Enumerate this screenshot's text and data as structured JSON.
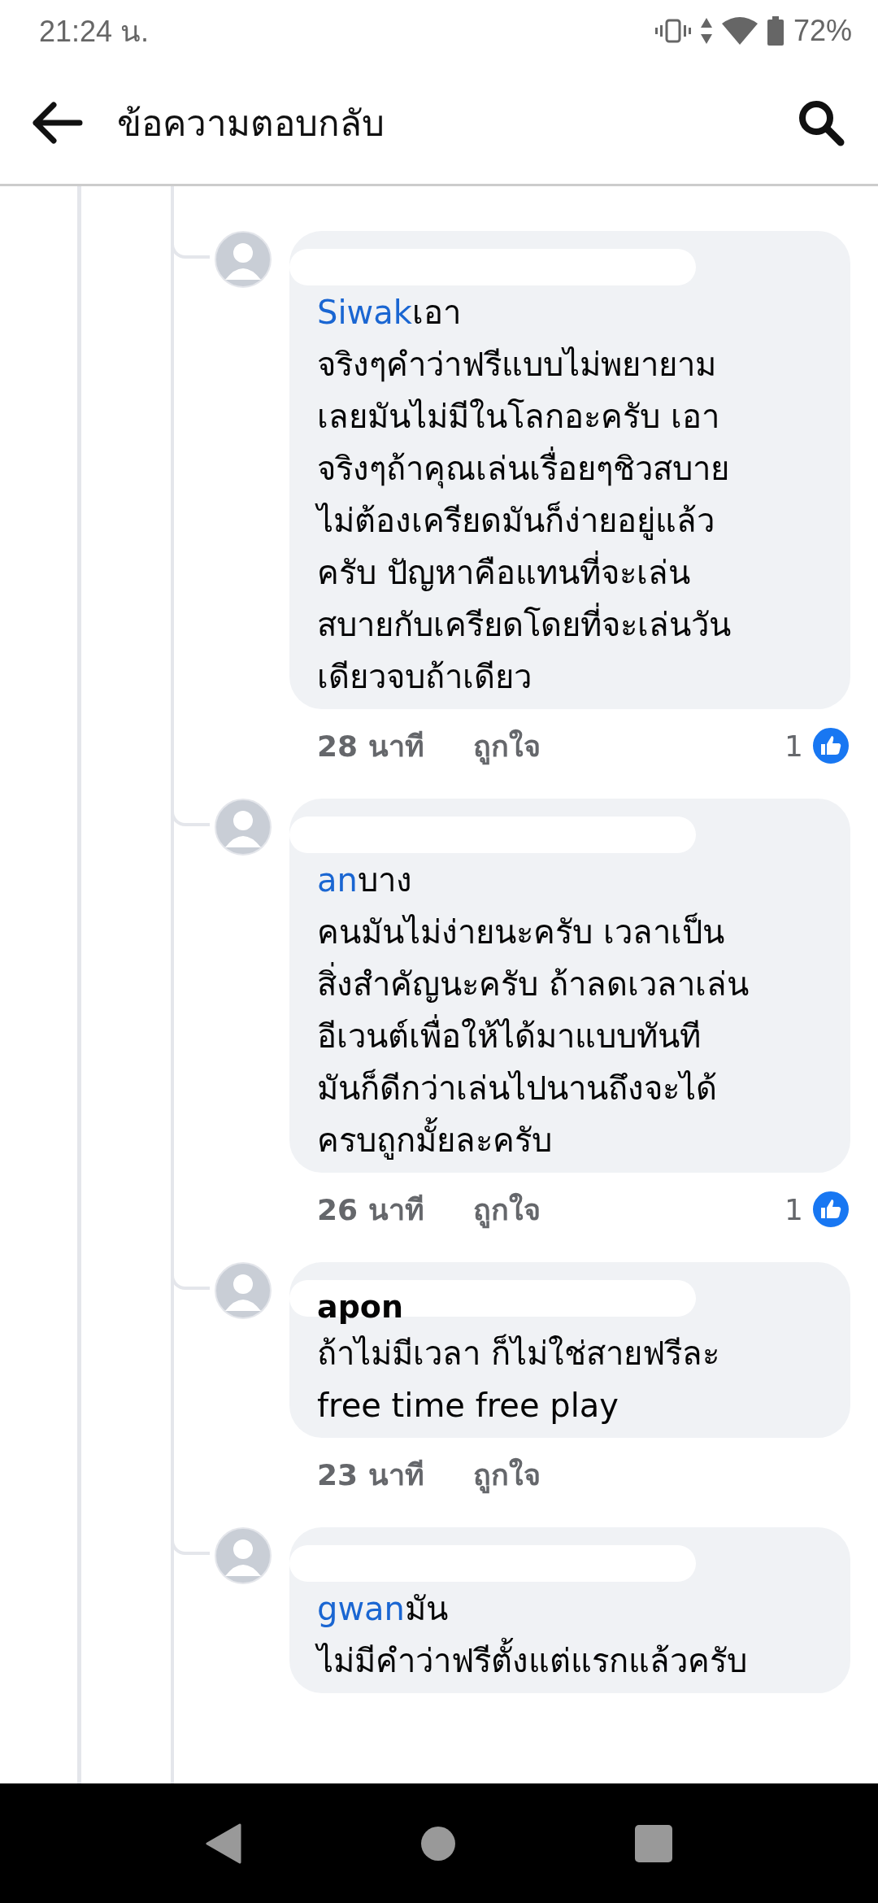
{
  "status_bar": {
    "time": "21:24 น.",
    "battery": "72%"
  },
  "app_bar": {
    "title": "ข้อความตอบกลับ"
  },
  "comments": [
    {
      "mention": "Siwak",
      "lines": [
        "เอา",
        "จริงๆคำว่าฟรีแบบไม่พยายาม",
        "เลยมันไม่มีในโลกอะครับ เอา",
        "จริงๆถ้าคุณเล่นเรื่อยๆชิวสบาย",
        "ไม่ต้องเครียดมันก็ง่ายอยู่แล้ว",
        "ครับ ปัญหาคือแทนที่จะเล่น",
        "สบายกับเครียดโดยที่จะเล่นวัน",
        "เดียวจบถ้าเดียว"
      ],
      "time": "28 นาที",
      "like_label": "ถูกใจ",
      "likes": "1"
    },
    {
      "mention": "an",
      "lines": [
        "บาง",
        "คนมันไม่ง่ายนะครับ เวลาเป็น",
        "สิ่งสำคัญนะครับ ถ้าลดเวลาเล่น",
        "อีเวนต์เพื่อให้ได้มาแบบทันที",
        "มันก็ดีกว่าเล่นไปนานถึงจะได้",
        "ครบถูกมั้ยละครับ"
      ],
      "time": "26 นาที",
      "like_label": "ถูกใจ",
      "likes": "1"
    },
    {
      "name": "apon",
      "lines": [
        "ถ้าไม่มีเวลา ก็ไม่ใช่สายฟรีละ",
        "free time free play"
      ],
      "time": "23 นาที",
      "like_label": "ถูกใจ"
    },
    {
      "mention": "gwan",
      "lines": [
        "มัน",
        "ไม่มีคำว่าฟรีตั้งแต่แรกแล้วครับ"
      ]
    }
  ]
}
